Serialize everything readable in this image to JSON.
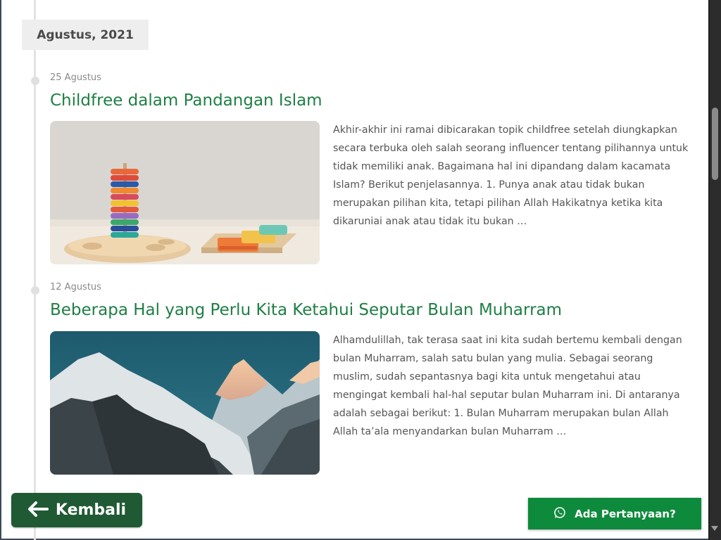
{
  "month_label": "Agustus, 2021",
  "posts": [
    {
      "date": "25 Agustus",
      "title": "Childfree dalam Pandangan Islam",
      "excerpt": "Akhir-akhir ini ramai dibicarakan topik childfree setelah diungkapkan secara terbuka oleh salah seorang influencer tentang pilihannya untuk tidak memiliki anak. Bagaimana hal ini dipandang dalam kacamata Islam? Berikut penjelasannya. 1. Punya anak atau tidak bukan merupakan pilihan kita, tetapi pilihan Allah Hakikatnya ketika kita dikaruniai anak atau tidak itu bukan …"
    },
    {
      "date": "12 Agustus",
      "title": "Beberapa Hal yang Perlu Kita Ketahui Seputar Bulan Muharram",
      "excerpt": "Alhamdulillah, tak terasa saat ini kita sudah bertemu kembali dengan bulan Muharram, salah satu bulan yang mulia. Sebagai seorang muslim, sudah sepantasnya bagi kita untuk mengetahui atau mengingat kembali hal-hal seputar bulan Muharram ini. Di antaranya adalah sebagai berikut: 1. Bulan Muharram merupakan bulan Allah Allah ta’ala menyandarkan bulan Muharram …"
    }
  ],
  "buttons": {
    "back_label": "Kembali",
    "ask_label": "Ada Pertanyaan?"
  },
  "colors": {
    "title_green": "#1e7f44",
    "back_button": "#1f5a34",
    "ask_button": "#0e8a3c"
  },
  "icons": {
    "back": "arrow-left-icon",
    "ask": "whatsapp-icon"
  }
}
